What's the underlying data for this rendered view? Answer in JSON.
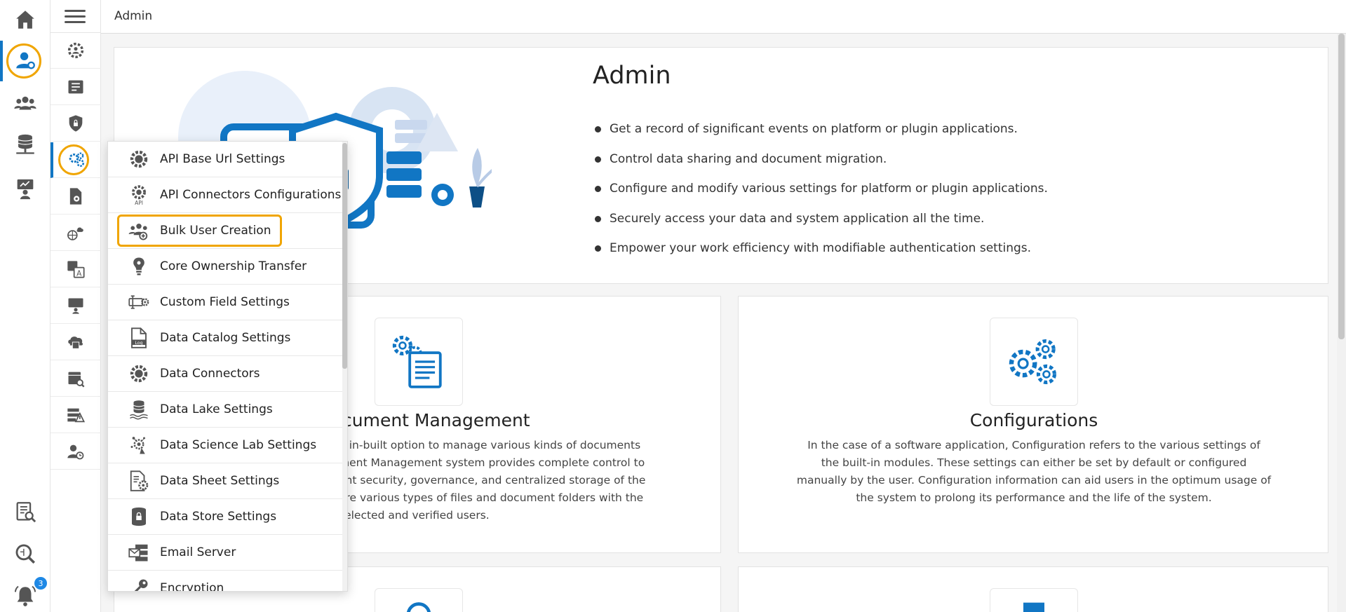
{
  "topbar": {
    "title": "Admin"
  },
  "hero": {
    "title": "Admin",
    "bullets": [
      "Get a record of significant events on platform or plugin applications.",
      "Control data sharing and document migration.",
      "Configure and modify various settings for platform or plugin applications.",
      "Securely access your data and system application all the time.",
      "Empower your work efficiency with modifiable authentication settings."
    ]
  },
  "cards": {
    "document": {
      "title": "cument Management",
      "lines": [
        "n in-built option to manage various kinds of documents",
        "ment Management system provides complete control to",
        "ent security, governance, and centralized storage of the",
        "are various types of files and document folders with the",
        "selected and verified users."
      ]
    },
    "config": {
      "title": "Configurations",
      "lines": [
        "In the case of a software application, Configuration refers to the various settings of",
        "the built-in modules. These settings can either be set by default or configured",
        "manually by the user. Configuration information can aid users in the optimum usage of",
        "the system to prolong its performance and the life of the system."
      ]
    }
  },
  "dropdown": {
    "items": [
      {
        "label": "API Base Url Settings",
        "icon": "gear-icon"
      },
      {
        "label": "API Connectors Configurations",
        "icon": "api-gear-icon"
      },
      {
        "label": "Bulk User Creation",
        "icon": "users-add-icon"
      },
      {
        "label": "Core Ownership Transfer",
        "icon": "bulb-icon"
      },
      {
        "label": "Custom Field Settings",
        "icon": "field-gear-icon"
      },
      {
        "label": "Data Catalog Settings",
        "icon": "log-file-icon"
      },
      {
        "label": "Data Connectors",
        "icon": "gear-icon"
      },
      {
        "label": "Data Lake Settings",
        "icon": "database-icon"
      },
      {
        "label": "Data Science Lab Settings",
        "icon": "science-icon"
      },
      {
        "label": "Data Sheet Settings",
        "icon": "sheet-gear-icon"
      },
      {
        "label": "Data Store Settings",
        "icon": "lock-database-icon"
      },
      {
        "label": "Email Server",
        "icon": "email-server-icon"
      },
      {
        "label": "Encryption",
        "icon": "key-icon"
      }
    ]
  },
  "notifications": {
    "count": "3"
  },
  "colors": {
    "accent": "#1176c4",
    "highlight": "#f0a500",
    "icon": "#555555"
  }
}
